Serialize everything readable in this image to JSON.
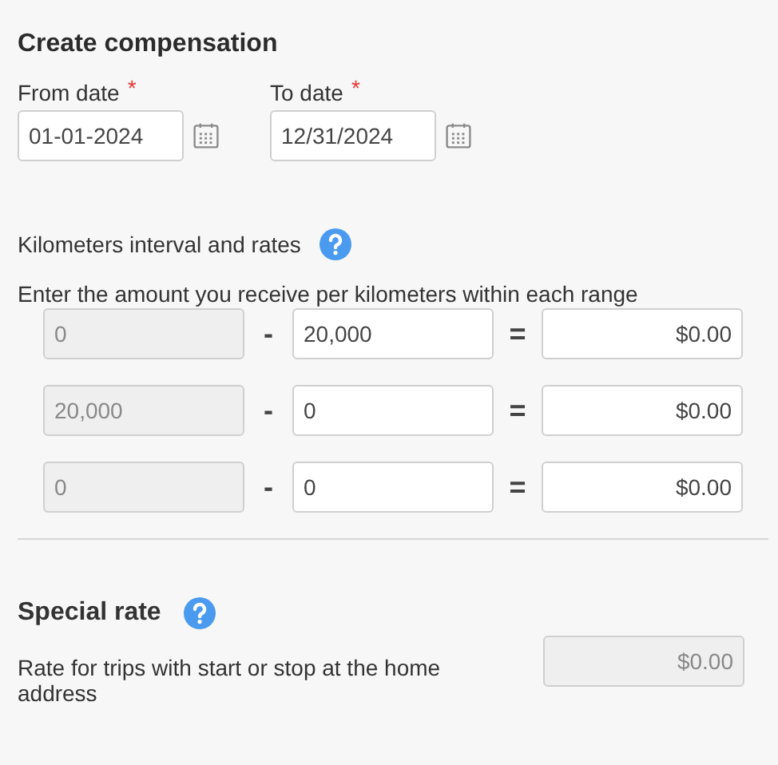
{
  "title": "Create compensation",
  "dates": [
    {
      "label": "From date",
      "required_mark": "*",
      "value": "01-01-2024"
    },
    {
      "label": "To date",
      "required_mark": "*",
      "value": "12/31/2024"
    }
  ],
  "intervals": {
    "heading": "Kilometers interval and rates",
    "help": true,
    "instruction": "Enter the amount you receive per kilometers within each range",
    "rows": [
      {
        "from": {
          "value": "0",
          "disabled": true
        },
        "dash": "-",
        "to": {
          "value": "20,000",
          "disabled": false
        },
        "equals": "=",
        "rate": {
          "value": "$0.00",
          "disabled": false
        }
      },
      {
        "from": {
          "value": "20,000",
          "disabled": true
        },
        "dash": "-",
        "to": {
          "value": "0",
          "disabled": false
        },
        "equals": "=",
        "rate": {
          "value": "$0.00",
          "disabled": false
        }
      },
      {
        "from": {
          "value": "0",
          "disabled": true
        },
        "dash": "-",
        "to": {
          "value": "0",
          "disabled": false
        },
        "equals": "=",
        "rate": {
          "value": "$0.00",
          "disabled": false
        }
      }
    ]
  },
  "special_rate": {
    "heading": "Special rate",
    "help": true,
    "description": "Rate for trips with start or stop at the home address",
    "rate": {
      "value": "$0.00",
      "disabled": true
    }
  }
}
